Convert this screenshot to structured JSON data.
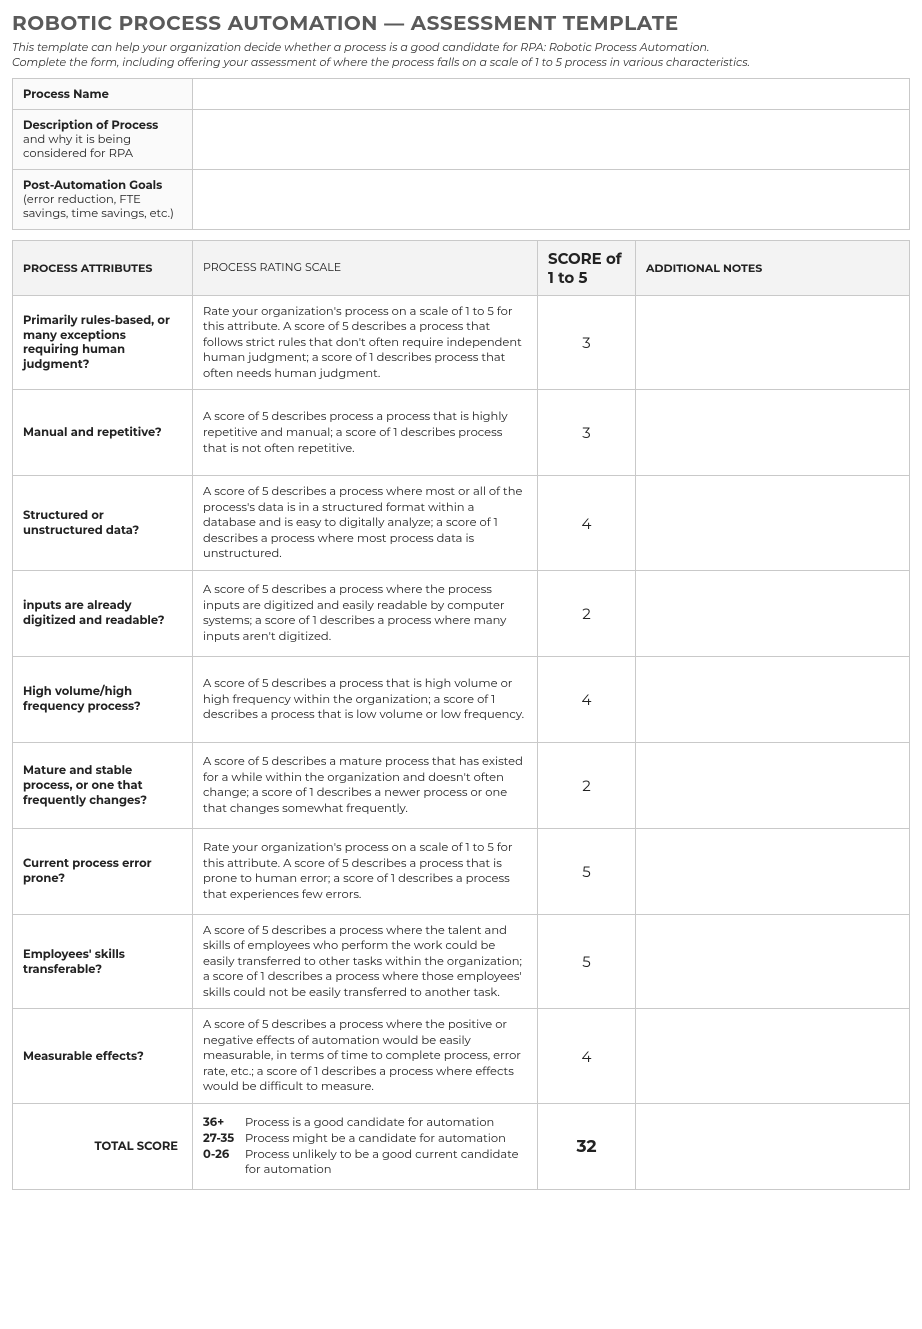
{
  "title": "ROBOTIC PROCESS AUTOMATION — ASSESSMENT TEMPLATE",
  "intro_line1": "This template can help your organization decide whether a process is a good candidate for RPA: Robotic Process Automation.",
  "intro_line2": "Complete the form, including offering your assessment of where the process falls on a scale of 1 to 5 process in various characteristics.",
  "info": {
    "process_name": {
      "bold": "Process Name",
      "sub": "",
      "value": ""
    },
    "description": {
      "bold": "Description of Process",
      "sub": "and why it is being considered for RPA",
      "value": ""
    },
    "goals": {
      "bold": "Post-Automation Goals",
      "sub": "(error reduction, FTE savings, time savings, etc.)",
      "value": ""
    }
  },
  "headers": {
    "attr": "PROCESS ATTRIBUTES",
    "scale": "PROCESS RATING SCALE",
    "score": "SCORE of 1 to 5",
    "notes": "ADDITIONAL NOTES"
  },
  "rows": [
    {
      "attr": "Primarily rules-based, or many exceptions requiring human judgment?",
      "scale": "Rate your organization's process on a scale of 1 to 5 for this attribute. A score of 5 describes a process that follows strict rules that don't often require independent human judgment; a score of 1 describes process that often needs human judgment.",
      "score": "3",
      "notes": ""
    },
    {
      "attr": "Manual and repetitive?",
      "scale": "A score of 5 describes process a process that is highly repetitive and manual; a score of 1 describes process that is not often repetitive.",
      "score": "3",
      "notes": ""
    },
    {
      "attr": "Structured or unstructured data?",
      "scale": "A score of 5 describes a process where most or all of the process's data is in a structured format within a database and is easy to digitally analyze; a score of 1 describes a process where most process data is unstructured.",
      "score": "4",
      "notes": ""
    },
    {
      "attr": "inputs are already digitized and readable?",
      "scale": "A score of 5 describes a process where the process inputs are digitized and easily readable by computer systems; a score of 1 describes a process where many inputs aren't digitized.",
      "score": "2",
      "notes": ""
    },
    {
      "attr": "High volume/high frequency process?",
      "scale": "A score of 5 describes a process that is high volume or high frequency within the organization; a score of 1 describes a process that is low volume or low frequency.",
      "score": "4",
      "notes": ""
    },
    {
      "attr": "Mature and stable process, or one that frequently changes?",
      "scale": "A score of 5 describes a mature process that has existed for a while within the organization and doesn't often change; a score of 1 describes a newer process or one that changes somewhat frequently.",
      "score": "2",
      "notes": ""
    },
    {
      "attr": "Current process error prone?",
      "scale": "Rate your organization's process on a scale of 1 to 5 for this attribute. A score of 5 describes a process that is prone to human error; a score of 1 describes a process that experiences few errors.",
      "score": "5",
      "notes": ""
    },
    {
      "attr": "Employees' skills transferable?",
      "scale": "A score of 5 describes a process where the talent and skills of employees who perform the work could be easily transferred to other tasks within the organization; a score of 1 describes a process where those employees' skills could not be easily transferred to another task.",
      "score": "5",
      "notes": ""
    },
    {
      "attr": "Measurable effects?",
      "scale": "A score of 5 describes a process where the positive or negative effects of automation would be easily measurable, in terms of time to complete process, error rate, etc.; a score of 1 describes a process where effects would be difficult to measure.",
      "score": "4",
      "notes": ""
    }
  ],
  "total": {
    "label": "TOTAL SCORE",
    "score": "32",
    "legend": {
      "a_range": "36+",
      "a_text": "Process is a good candidate for automation",
      "b_range": "27-35",
      "b_text": "Process might be a candidate for automation",
      "c_range": "0-26",
      "c_text": "Process unlikely to be a good current candidate",
      "c_text2": "for automation"
    }
  }
}
